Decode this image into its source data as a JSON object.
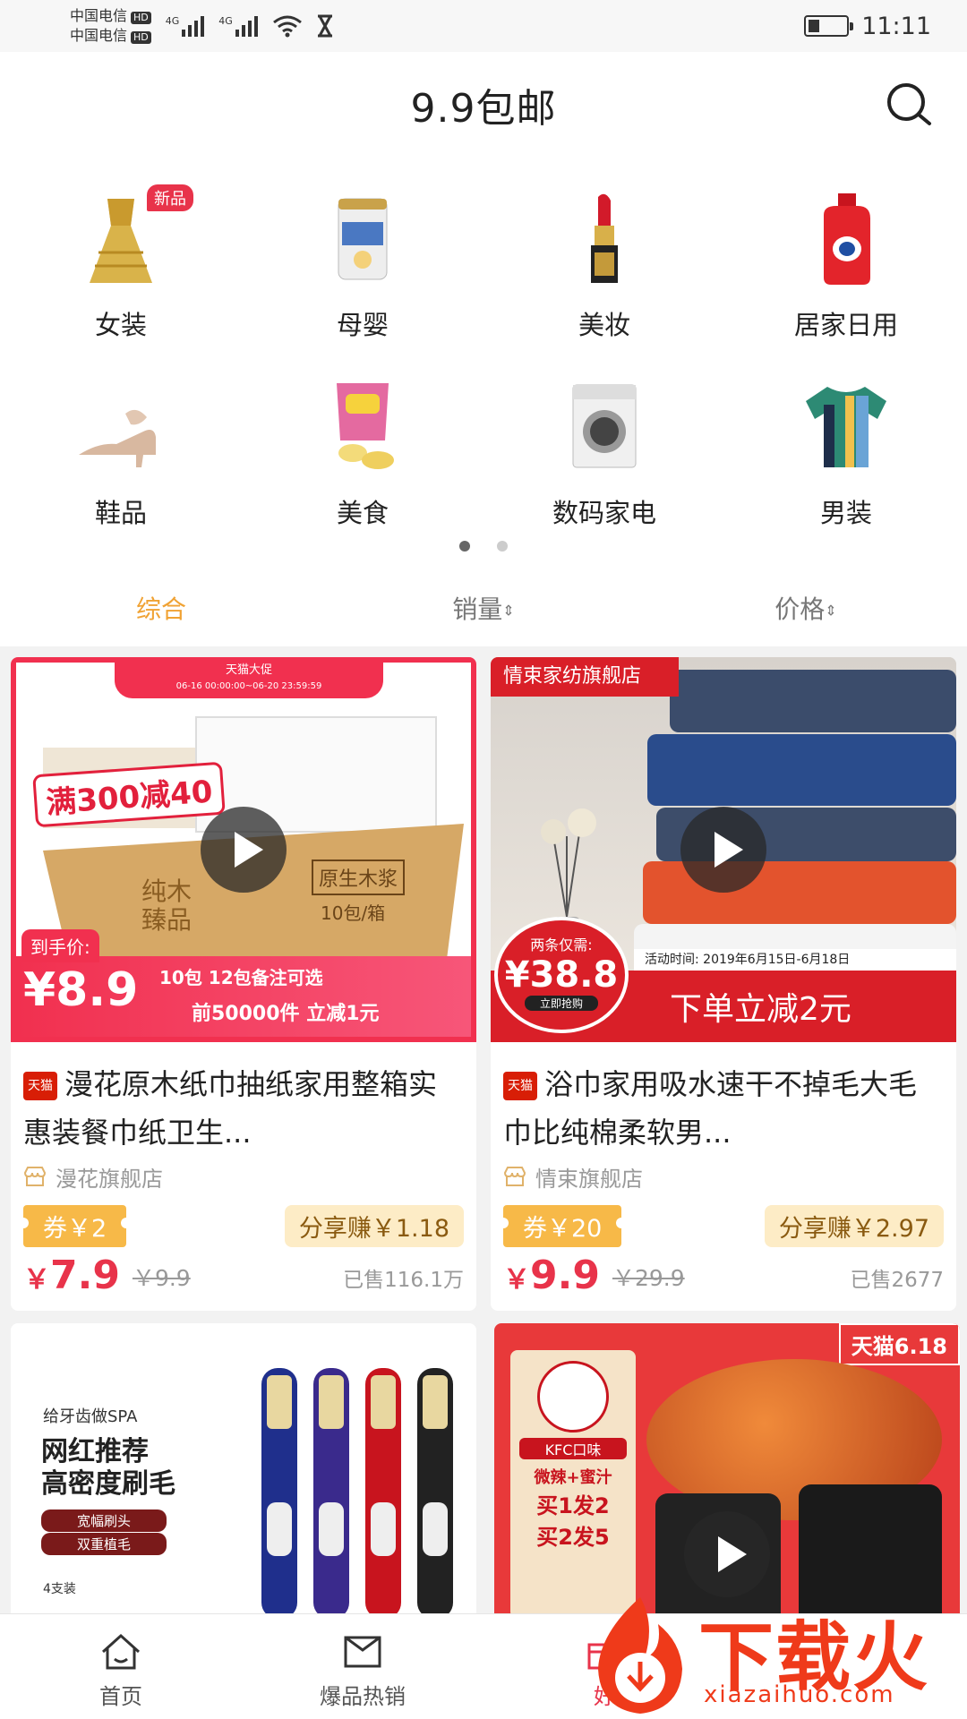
{
  "status_bar": {
    "carrier1": "中国电信",
    "carrier2": "中国电信",
    "hd": "HD",
    "net1": "4G",
    "net2": "4G",
    "time": "11:11"
  },
  "header": {
    "title": "9.9包邮"
  },
  "categories": [
    {
      "label": "女装",
      "icon": "dress-icon",
      "badge": "新品"
    },
    {
      "label": "母婴",
      "icon": "milk-powder-icon"
    },
    {
      "label": "美妆",
      "icon": "lipstick-icon"
    },
    {
      "label": "居家日用",
      "icon": "detergent-bottle-icon"
    },
    {
      "label": "鞋品",
      "icon": "high-heel-icon"
    },
    {
      "label": "美食",
      "icon": "snack-bag-icon"
    },
    {
      "label": "数码家电",
      "icon": "washing-machine-icon"
    },
    {
      "label": "男装",
      "icon": "tshirt-icon"
    }
  ],
  "sort_tabs": [
    {
      "label": "综合",
      "active": true
    },
    {
      "label": "销量",
      "arrow": "⇕"
    },
    {
      "label": "价格",
      "arrow": "⇕"
    }
  ],
  "products": [
    {
      "promo_top": "天猫大促",
      "promo_date": "06-16 00:00:00~06-20 23:59:59",
      "promo_main": "满300减40",
      "promo_price_label": "到手价:",
      "promo_price": "¥8.9",
      "promo_line1": "10包  12包备注可选",
      "promo_line2": "前50000件  立减1元",
      "box_text1": "纯木臻品",
      "box_text2": "原生木浆",
      "box_text3": "10包/箱",
      "tmall": "天猫",
      "title": "漫花原木纸巾抽纸家用整箱实惠装餐巾纸卫生...",
      "shop": "漫花旗舰店",
      "coupon": "券￥2",
      "share": "分享赚￥1.18",
      "price_symbol": "￥",
      "price": "7.9",
      "original_price": "￥9.9",
      "sold": "已售116.1万"
    },
    {
      "promo_store": "情束家纺旗舰店",
      "promo_price_label": "两条仅需:",
      "promo_price": "¥38.8",
      "promo_btn": "立即抢购",
      "promo_time": "活动时间: 2019年6月15日-6月18日",
      "promo_main": "下单立减2元",
      "tmall": "天猫",
      "title": "浴巾家用吸水速干不掉毛大毛巾比纯棉柔软男...",
      "shop": "情束旗舰店",
      "coupon": "券￥20",
      "share": "分享赚￥2.97",
      "price_symbol": "￥",
      "price": "9.9",
      "original_price": "￥29.9",
      "sold": "已售2677"
    },
    {
      "promo_brand": "给牙齿做SPA",
      "promo_line1": "网红推荐",
      "promo_line2": "高密度刷毛",
      "promo_tag1": "宽幅刷头",
      "promo_tag2": "双重植毛",
      "promo_count": "4支装"
    },
    {
      "promo_corner": "天猫6.18",
      "promo_brand": "KFC口味",
      "promo_line1": "微辣+蜜汁",
      "promo_line2": "买1发2",
      "promo_line3": "买2发5"
    }
  ],
  "tabbar": [
    {
      "label": "首页",
      "icon": "home-icon"
    },
    {
      "label": "爆品热销",
      "icon": "flag-icon"
    },
    {
      "label": "好",
      "icon": "gift-icon",
      "active": true
    }
  ],
  "watermark": {
    "text": "下载火",
    "url": "xiazaihuo.com"
  }
}
